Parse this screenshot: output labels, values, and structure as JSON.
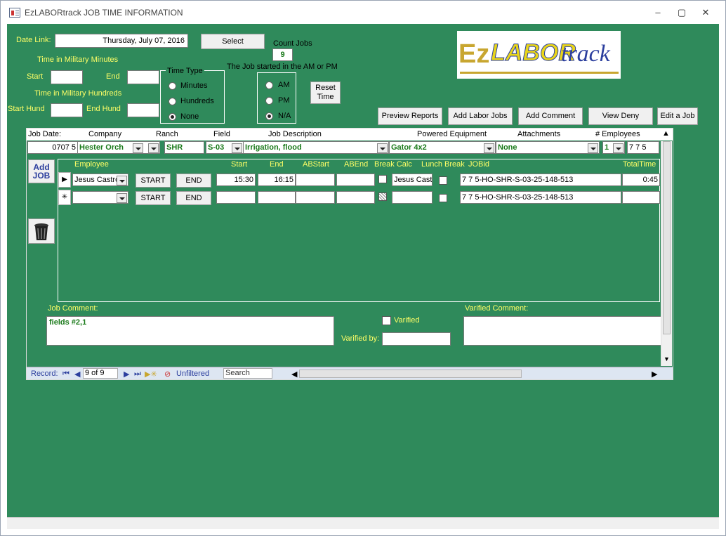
{
  "window": {
    "title": "EzLABORtrack JOB TIME INFORMATION",
    "minimize": "🗕",
    "maximize": "🗖",
    "close": "✕"
  },
  "header": {
    "date_link_label": "Date Link:",
    "date_value": "Thursday, July 07, 2016",
    "select_button": "Select",
    "count_jobs_label": "Count Jobs",
    "count_jobs_value": "9",
    "military_minutes_label": "Time in Military Minutes",
    "start_label": "Start",
    "end_label": "End",
    "military_hundreds_label": "Time in Military Hundreds",
    "start_hund_label": "Start Hund",
    "end_hund_label": "End Hund",
    "time_type": {
      "label": "Time Type",
      "options": [
        "Minutes",
        "Hundreds",
        "None"
      ],
      "selected": "None"
    },
    "am_pm": {
      "label": "The Job started in the AM or PM",
      "options": [
        "AM",
        "PM",
        "N/A"
      ],
      "selected": "N/A"
    },
    "reset_button": "Reset\nTime",
    "logo": {
      "ez": "Ez",
      "labor": "LABOR",
      "track": "track"
    },
    "buttons": {
      "preview_reports": "Preview Reports",
      "add_labor_jobs": "Add Labor Jobs",
      "add_comment": "Add Comment",
      "view_deny": "View Deny",
      "edit_job": "Edit a Job"
    }
  },
  "job": {
    "columns": [
      "Job Date:",
      "Company",
      "Ranch",
      "Field",
      "Job Description",
      "Powered Equipment",
      "Attachments",
      "# Employees"
    ],
    "values": {
      "job_date": "0707 5",
      "company": "Hester Orch",
      "ranch": "SHR",
      "field": "S-03",
      "description": "Irrigation, flood",
      "equipment": "Gator 4x2",
      "attachments": "None",
      "employees": "1",
      "extra": "7 7 5"
    }
  },
  "add_job": "Add\nJOB",
  "employees": {
    "columns": [
      "Employee",
      "Start",
      "End",
      "ABStart",
      "ABEnd",
      "Break Calc",
      "Lunch Break",
      "JOBid",
      "TotalTime"
    ],
    "start_button": "START",
    "end_button": "END",
    "rows": [
      {
        "selector": "▶",
        "employee": "Jesus Castro",
        "start": "15:30",
        "end": "16:15",
        "abstart": "",
        "abend": "",
        "break_calc": "Jesus Cast",
        "jobid": "7 7 5-HO-SHR-S-03-25-148-513",
        "totaltime": "0:45"
      },
      {
        "selector": "✳",
        "employee": "",
        "start": "",
        "end": "",
        "abstart": "",
        "abend": "",
        "break_calc": "",
        "jobid": "7 7 5-HO-SHR-S-03-25-148-513",
        "totaltime": ""
      }
    ]
  },
  "comments": {
    "job_comment_label": "Job Comment:",
    "job_comment_value": "fields #2,1",
    "varified_label": "Varified",
    "varified_by_label": "Varified by:",
    "varified_comment_label": "Varified Comment:"
  },
  "record_nav": {
    "record_label": "Record:",
    "position": "9 of 9",
    "filter": "Unfiltered",
    "search": "Search"
  }
}
